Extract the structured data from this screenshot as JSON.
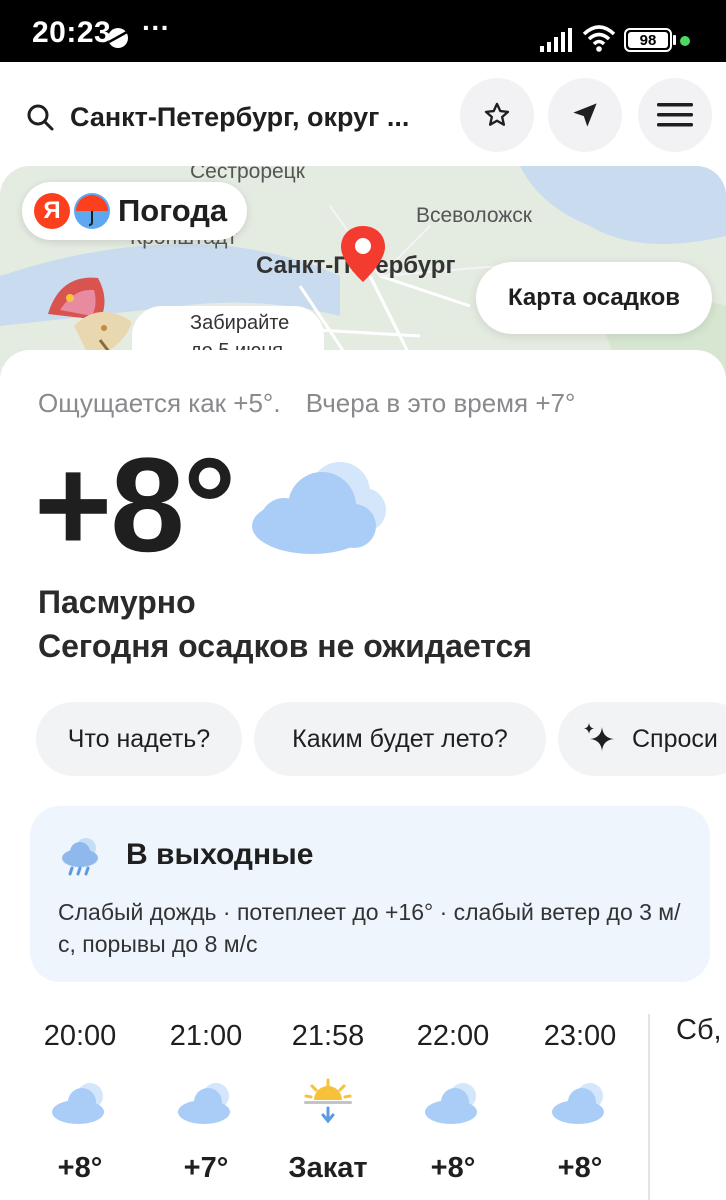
{
  "status_bar": {
    "time": "20:23",
    "dots": "···",
    "battery": "98",
    "accent_dot_color": "#4cd964"
  },
  "header": {
    "search_text": "Санкт-Петербург, округ ...",
    "icons": [
      "search-icon",
      "star-icon",
      "location-arrow-icon",
      "menu-icon"
    ]
  },
  "map": {
    "logo_text": "Погода",
    "logo_ya": "Я",
    "labels": {
      "sestroretsk": "Сестрорецк",
      "kronshtadt": "Кронштадт",
      "vsevolozhsk": "Всеволожск",
      "spb": "Санкт-Петербург"
    },
    "precip_button": "Карта осадков",
    "promo_line1": "Забирайте",
    "promo_line2": "до 5 июня"
  },
  "current": {
    "feels_like": "Ощущается как +5°.",
    "yesterday": "Вчера в это время +7°",
    "temperature": "+8°",
    "condition": "Пасмурно",
    "precip_note": "Сегодня осадков не ожидается"
  },
  "chips": [
    {
      "label": "Что надеть?"
    },
    {
      "label": "Каким будет лето?"
    },
    {
      "label": "Спроси"
    }
  ],
  "weekend": {
    "title": "В выходные",
    "description": "Слабый дождь · потеплеет до +16° · слабый ветер до 3 м/с, порывы до 8 м/с"
  },
  "hourly": [
    {
      "time": "20:00",
      "icon": "cloud-icon",
      "value": "+8°"
    },
    {
      "time": "21:00",
      "icon": "cloud-icon",
      "value": "+7°"
    },
    {
      "time": "21:58",
      "icon": "sunset-icon",
      "value": "Закат"
    },
    {
      "time": "22:00",
      "icon": "cloud-icon",
      "value": "+8°"
    },
    {
      "time": "23:00",
      "icon": "cloud-icon",
      "value": "+8°"
    }
  ],
  "next_day": {
    "label": "Сб,"
  },
  "colors": {
    "brand_red": "#fc3f1d",
    "cloud_blue": "#a9cdf7",
    "weekend_bg": "#eef5fd",
    "chip_bg": "#f2f3f5"
  }
}
